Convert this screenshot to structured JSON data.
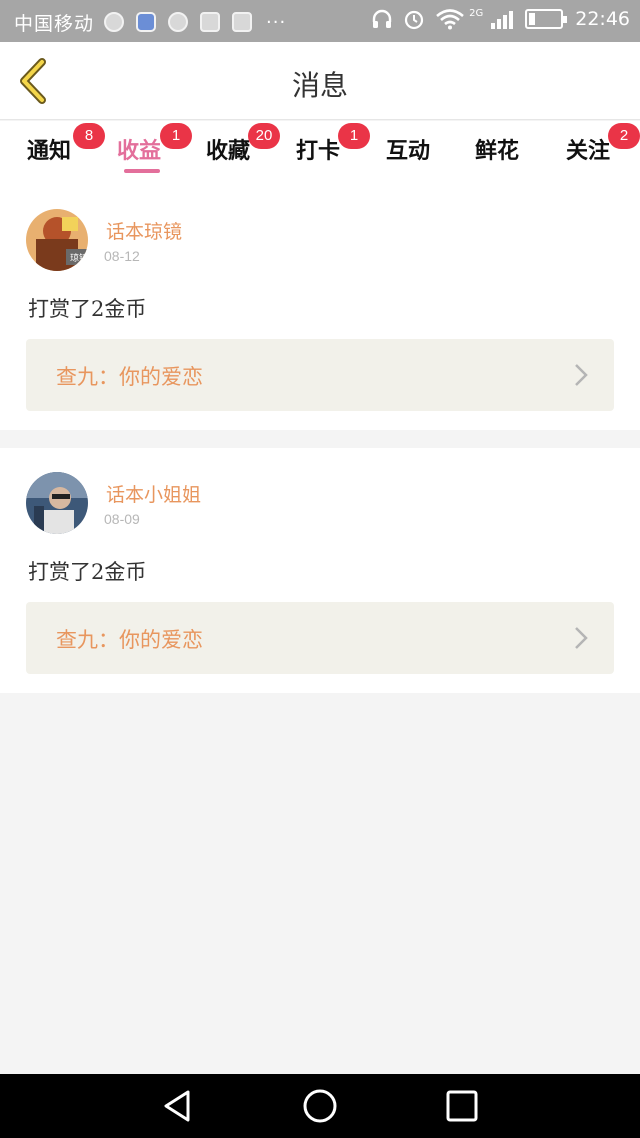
{
  "status_bar": {
    "carrier": "中国移动",
    "network": "2G",
    "time": "22:46"
  },
  "header": {
    "title": "消息",
    "back_icon": "chevron-left-icon"
  },
  "tabs": [
    {
      "label": "通知",
      "badge": "8"
    },
    {
      "label": "收益",
      "badge": "1",
      "active": true
    },
    {
      "label": "收藏",
      "badge": "20"
    },
    {
      "label": "打卡",
      "badge": "1"
    },
    {
      "label": "互动",
      "badge": ""
    },
    {
      "label": "鲜花",
      "badge": ""
    },
    {
      "label": "关注",
      "badge": "2"
    }
  ],
  "messages": [
    {
      "username": "话本琼镜",
      "date": "08-12",
      "action": "打赏了2金币",
      "quote": "查九：你的爱恋"
    },
    {
      "username": "话本小姐姐",
      "date": "08-09",
      "action": "打赏了2金币",
      "quote": "查九：你的爱恋"
    }
  ],
  "colors": {
    "accent": "#e36f9b",
    "badge": "#ea3447",
    "username": "#e8965e",
    "quote_bg": "#f2f1ea"
  }
}
